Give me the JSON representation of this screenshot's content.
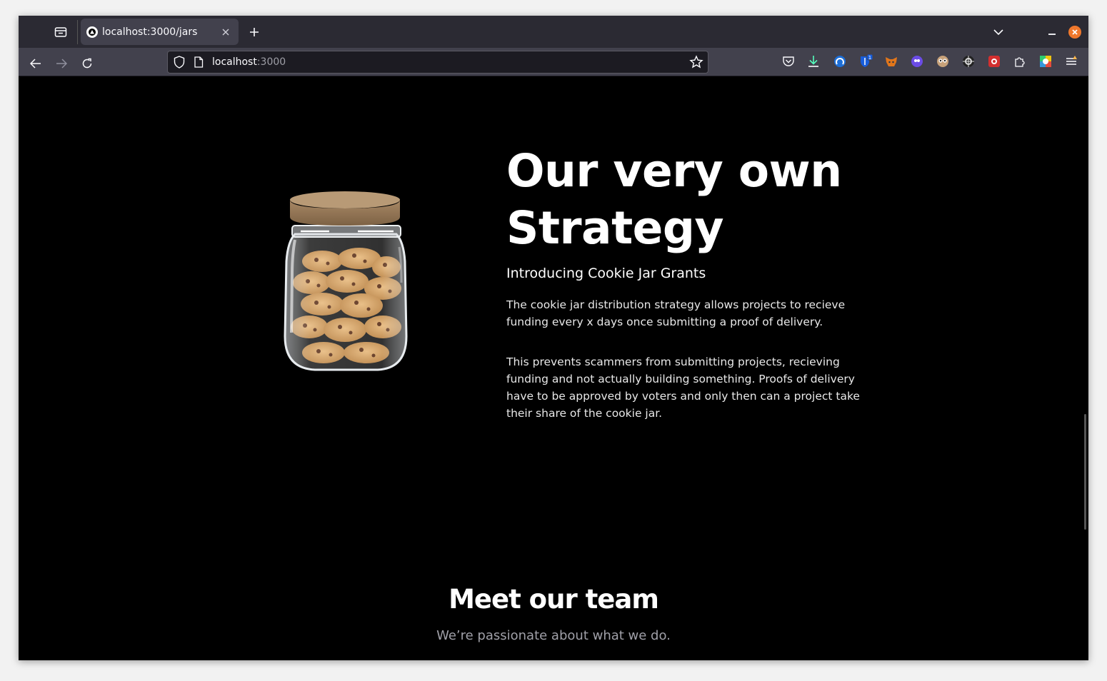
{
  "browser": {
    "tab_title": "localhost:3000/jars",
    "url_host": "localhost",
    "url_port": ":3000"
  },
  "extensions": [
    {
      "name": "pocket-icon"
    },
    {
      "name": "download-icon"
    },
    {
      "name": "extension-blue-icon"
    },
    {
      "name": "bitwarden-icon",
      "badge": "1"
    },
    {
      "name": "metamask-icon"
    },
    {
      "name": "extension-purple-icon"
    },
    {
      "name": "extension-eyes-icon"
    },
    {
      "name": "extension-dark-icon"
    },
    {
      "name": "extension-red-icon"
    },
    {
      "name": "extensions-puzzle-icon"
    },
    {
      "name": "extension-multicolor-icon"
    },
    {
      "name": "menu-icon"
    }
  ],
  "hero": {
    "heading_line1": "Our very own",
    "heading_line2": "Strategy",
    "subheading": "Introducing Cookie Jar Grants",
    "paragraph1": "The cookie jar distribution strategy allows projects to recieve funding every x days once submitting a proof of delivery.",
    "paragraph2": "This prevents scammers from submitting projects, recieving funding and not actually building something. Proofs of delivery have to be approved by voters and only then can a project take their share of the cookie jar."
  },
  "team": {
    "title": "Meet our team",
    "subtitle": "We’re passionate about what we do."
  }
}
